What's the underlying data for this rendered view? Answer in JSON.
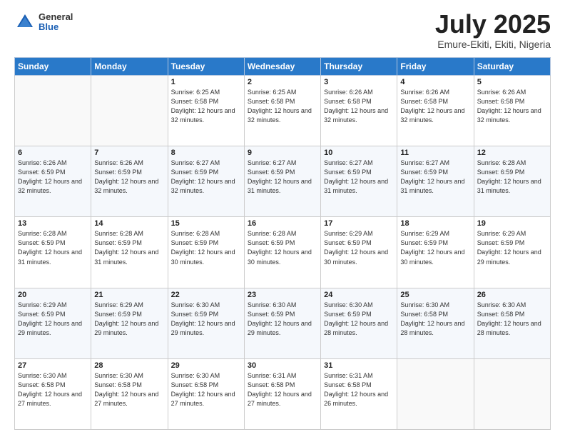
{
  "header": {
    "logo_general": "General",
    "logo_blue": "Blue",
    "title": "July 2025",
    "location": "Emure-Ekiti, Ekiti, Nigeria"
  },
  "days_of_week": [
    "Sunday",
    "Monday",
    "Tuesday",
    "Wednesday",
    "Thursday",
    "Friday",
    "Saturday"
  ],
  "weeks": [
    [
      {
        "day": "",
        "sunrise": "",
        "sunset": "",
        "daylight": ""
      },
      {
        "day": "",
        "sunrise": "",
        "sunset": "",
        "daylight": ""
      },
      {
        "day": "1",
        "sunrise": "Sunrise: 6:25 AM",
        "sunset": "Sunset: 6:58 PM",
        "daylight": "Daylight: 12 hours and 32 minutes."
      },
      {
        "day": "2",
        "sunrise": "Sunrise: 6:25 AM",
        "sunset": "Sunset: 6:58 PM",
        "daylight": "Daylight: 12 hours and 32 minutes."
      },
      {
        "day": "3",
        "sunrise": "Sunrise: 6:26 AM",
        "sunset": "Sunset: 6:58 PM",
        "daylight": "Daylight: 12 hours and 32 minutes."
      },
      {
        "day": "4",
        "sunrise": "Sunrise: 6:26 AM",
        "sunset": "Sunset: 6:58 PM",
        "daylight": "Daylight: 12 hours and 32 minutes."
      },
      {
        "day": "5",
        "sunrise": "Sunrise: 6:26 AM",
        "sunset": "Sunset: 6:58 PM",
        "daylight": "Daylight: 12 hours and 32 minutes."
      }
    ],
    [
      {
        "day": "6",
        "sunrise": "Sunrise: 6:26 AM",
        "sunset": "Sunset: 6:59 PM",
        "daylight": "Daylight: 12 hours and 32 minutes."
      },
      {
        "day": "7",
        "sunrise": "Sunrise: 6:26 AM",
        "sunset": "Sunset: 6:59 PM",
        "daylight": "Daylight: 12 hours and 32 minutes."
      },
      {
        "day": "8",
        "sunrise": "Sunrise: 6:27 AM",
        "sunset": "Sunset: 6:59 PM",
        "daylight": "Daylight: 12 hours and 32 minutes."
      },
      {
        "day": "9",
        "sunrise": "Sunrise: 6:27 AM",
        "sunset": "Sunset: 6:59 PM",
        "daylight": "Daylight: 12 hours and 31 minutes."
      },
      {
        "day": "10",
        "sunrise": "Sunrise: 6:27 AM",
        "sunset": "Sunset: 6:59 PM",
        "daylight": "Daylight: 12 hours and 31 minutes."
      },
      {
        "day": "11",
        "sunrise": "Sunrise: 6:27 AM",
        "sunset": "Sunset: 6:59 PM",
        "daylight": "Daylight: 12 hours and 31 minutes."
      },
      {
        "day": "12",
        "sunrise": "Sunrise: 6:28 AM",
        "sunset": "Sunset: 6:59 PM",
        "daylight": "Daylight: 12 hours and 31 minutes."
      }
    ],
    [
      {
        "day": "13",
        "sunrise": "Sunrise: 6:28 AM",
        "sunset": "Sunset: 6:59 PM",
        "daylight": "Daylight: 12 hours and 31 minutes."
      },
      {
        "day": "14",
        "sunrise": "Sunrise: 6:28 AM",
        "sunset": "Sunset: 6:59 PM",
        "daylight": "Daylight: 12 hours and 31 minutes."
      },
      {
        "day": "15",
        "sunrise": "Sunrise: 6:28 AM",
        "sunset": "Sunset: 6:59 PM",
        "daylight": "Daylight: 12 hours and 30 minutes."
      },
      {
        "day": "16",
        "sunrise": "Sunrise: 6:28 AM",
        "sunset": "Sunset: 6:59 PM",
        "daylight": "Daylight: 12 hours and 30 minutes."
      },
      {
        "day": "17",
        "sunrise": "Sunrise: 6:29 AM",
        "sunset": "Sunset: 6:59 PM",
        "daylight": "Daylight: 12 hours and 30 minutes."
      },
      {
        "day": "18",
        "sunrise": "Sunrise: 6:29 AM",
        "sunset": "Sunset: 6:59 PM",
        "daylight": "Daylight: 12 hours and 30 minutes."
      },
      {
        "day": "19",
        "sunrise": "Sunrise: 6:29 AM",
        "sunset": "Sunset: 6:59 PM",
        "daylight": "Daylight: 12 hours and 29 minutes."
      }
    ],
    [
      {
        "day": "20",
        "sunrise": "Sunrise: 6:29 AM",
        "sunset": "Sunset: 6:59 PM",
        "daylight": "Daylight: 12 hours and 29 minutes."
      },
      {
        "day": "21",
        "sunrise": "Sunrise: 6:29 AM",
        "sunset": "Sunset: 6:59 PM",
        "daylight": "Daylight: 12 hours and 29 minutes."
      },
      {
        "day": "22",
        "sunrise": "Sunrise: 6:30 AM",
        "sunset": "Sunset: 6:59 PM",
        "daylight": "Daylight: 12 hours and 29 minutes."
      },
      {
        "day": "23",
        "sunrise": "Sunrise: 6:30 AM",
        "sunset": "Sunset: 6:59 PM",
        "daylight": "Daylight: 12 hours and 29 minutes."
      },
      {
        "day": "24",
        "sunrise": "Sunrise: 6:30 AM",
        "sunset": "Sunset: 6:59 PM",
        "daylight": "Daylight: 12 hours and 28 minutes."
      },
      {
        "day": "25",
        "sunrise": "Sunrise: 6:30 AM",
        "sunset": "Sunset: 6:58 PM",
        "daylight": "Daylight: 12 hours and 28 minutes."
      },
      {
        "day": "26",
        "sunrise": "Sunrise: 6:30 AM",
        "sunset": "Sunset: 6:58 PM",
        "daylight": "Daylight: 12 hours and 28 minutes."
      }
    ],
    [
      {
        "day": "27",
        "sunrise": "Sunrise: 6:30 AM",
        "sunset": "Sunset: 6:58 PM",
        "daylight": "Daylight: 12 hours and 27 minutes."
      },
      {
        "day": "28",
        "sunrise": "Sunrise: 6:30 AM",
        "sunset": "Sunset: 6:58 PM",
        "daylight": "Daylight: 12 hours and 27 minutes."
      },
      {
        "day": "29",
        "sunrise": "Sunrise: 6:30 AM",
        "sunset": "Sunset: 6:58 PM",
        "daylight": "Daylight: 12 hours and 27 minutes."
      },
      {
        "day": "30",
        "sunrise": "Sunrise: 6:31 AM",
        "sunset": "Sunset: 6:58 PM",
        "daylight": "Daylight: 12 hours and 27 minutes."
      },
      {
        "day": "31",
        "sunrise": "Sunrise: 6:31 AM",
        "sunset": "Sunset: 6:58 PM",
        "daylight": "Daylight: 12 hours and 26 minutes."
      },
      {
        "day": "",
        "sunrise": "",
        "sunset": "",
        "daylight": ""
      },
      {
        "day": "",
        "sunrise": "",
        "sunset": "",
        "daylight": ""
      }
    ]
  ]
}
